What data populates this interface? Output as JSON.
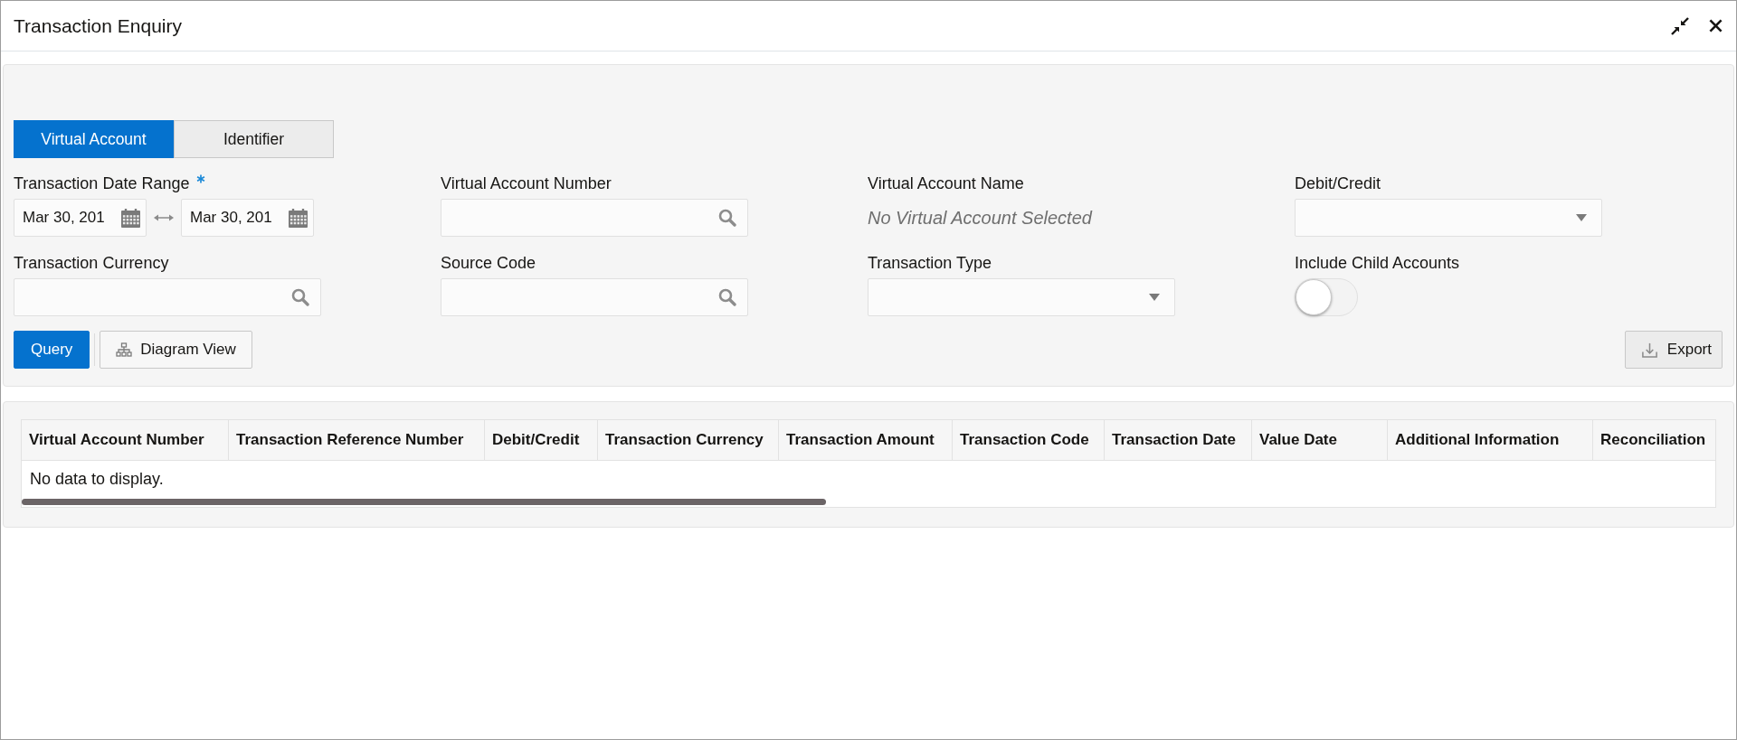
{
  "window": {
    "title": "Transaction Enquiry"
  },
  "tabs": [
    {
      "label": "Virtual Account",
      "selected": true
    },
    {
      "label": "Identifier",
      "selected": false
    }
  ],
  "fields": [
    {
      "kind": "date_range",
      "label": "Transaction Date Range",
      "required": true,
      "from": "Mar 30, 201",
      "to": "Mar 30, 201"
    },
    {
      "kind": "search",
      "label": "Virtual Account Number",
      "required": false
    },
    {
      "kind": "display",
      "label": "Virtual Account Name",
      "required": false,
      "value": "No Virtual Account Selected"
    },
    {
      "kind": "select",
      "label": "Debit/Credit",
      "required": false
    },
    {
      "kind": "search",
      "label": "Transaction Currency",
      "required": false
    },
    {
      "kind": "search",
      "label": "Source Code",
      "required": false
    },
    {
      "kind": "select",
      "label": "Transaction Type",
      "required": false
    },
    {
      "kind": "toggle",
      "label": "Include Child Accounts",
      "required": false,
      "on": false
    }
  ],
  "actions": [
    {
      "kind": "primary",
      "label": "Query"
    },
    {
      "kind": "diagram",
      "label": "Diagram View"
    }
  ],
  "export_button": {
    "label": "Export"
  },
  "table": {
    "columns": [
      "Virtual Account Number",
      "Transaction Reference Number",
      "Debit/Credit",
      "Transaction Currency",
      "Transaction Amount",
      "Transaction Code",
      "Transaction Date",
      "Value Date",
      "Additional Information",
      "Reconciliation"
    ],
    "empty_message": "No data to display."
  }
}
